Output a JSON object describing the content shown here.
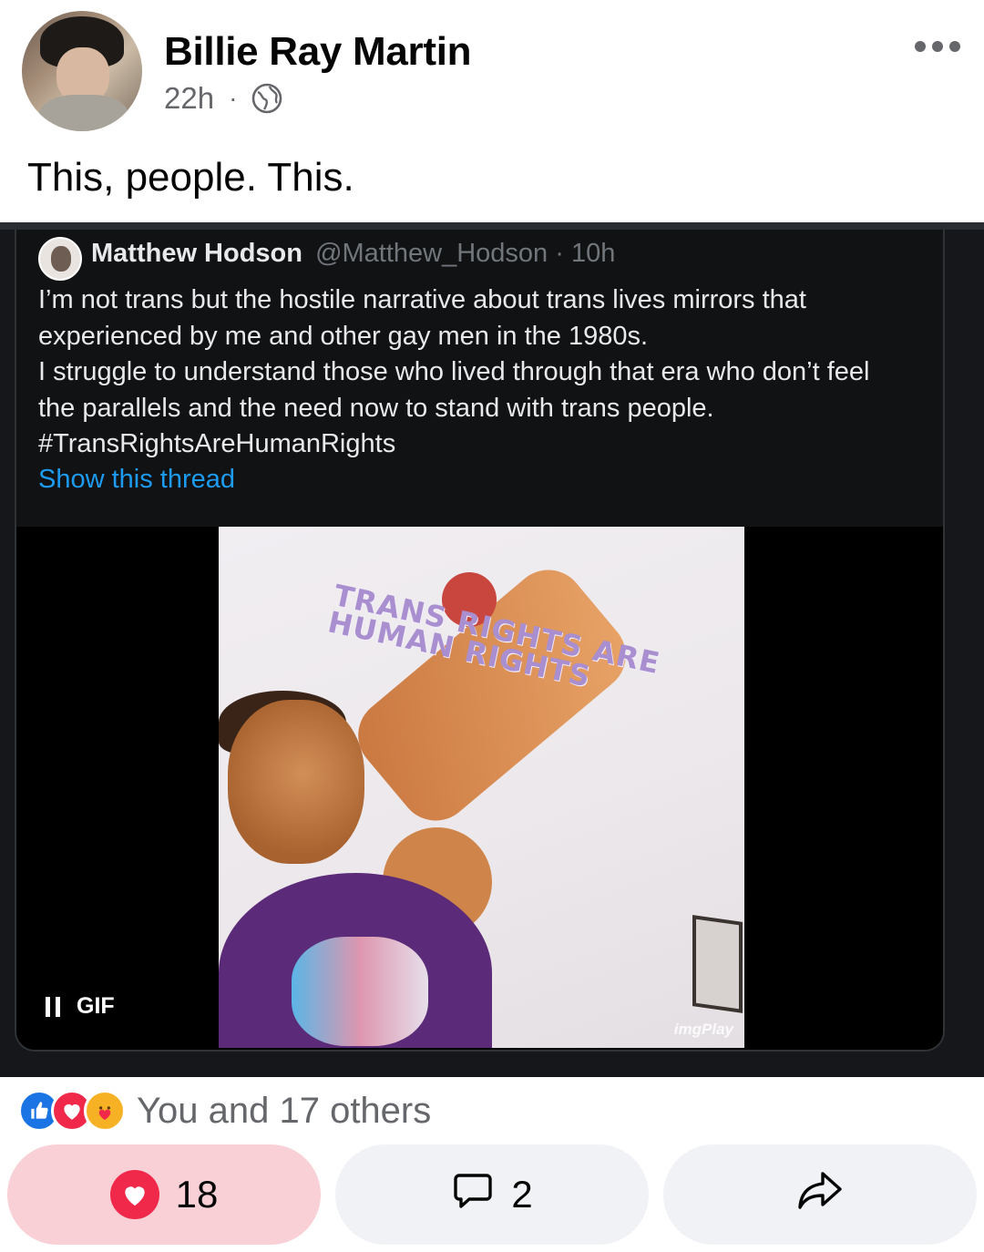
{
  "post": {
    "author": "Billie Ray Martin",
    "time": "22h",
    "separator": "·",
    "privacy_icon": "globe-icon",
    "text": "This, people. This."
  },
  "tweet": {
    "name": "Matthew Hodson",
    "handle": "@Matthew_Hodson · 10h",
    "lines": [
      "I’m not trans but the hostile narrative about trans lives mirrors that",
      "experienced by me and other gay men in the 1980s.",
      "I struggle to understand those who lived through that era who don’t feel",
      "the parallels and the need now to stand with trans people.",
      "#TransRightsAreHumanRights"
    ],
    "show_thread": "Show this thread",
    "gif": {
      "caption_line1": "TRANS RIGHTS ARE",
      "caption_line2": "HUMAN RIGHTS",
      "watermark": "imgPlay",
      "badge": "GIF"
    }
  },
  "reactions": {
    "icons": [
      "like-icon",
      "love-icon",
      "care-icon"
    ],
    "summary": "You and 17 others"
  },
  "actions": {
    "like_count": "18",
    "comment_count": "2"
  },
  "colors": {
    "like_blue": "#1b74e4",
    "love_red": "#f0284a",
    "care_yellow": "#f7b125",
    "twitter_link": "#1d9bf0",
    "liked_button_bg": "#f8d0d6"
  }
}
